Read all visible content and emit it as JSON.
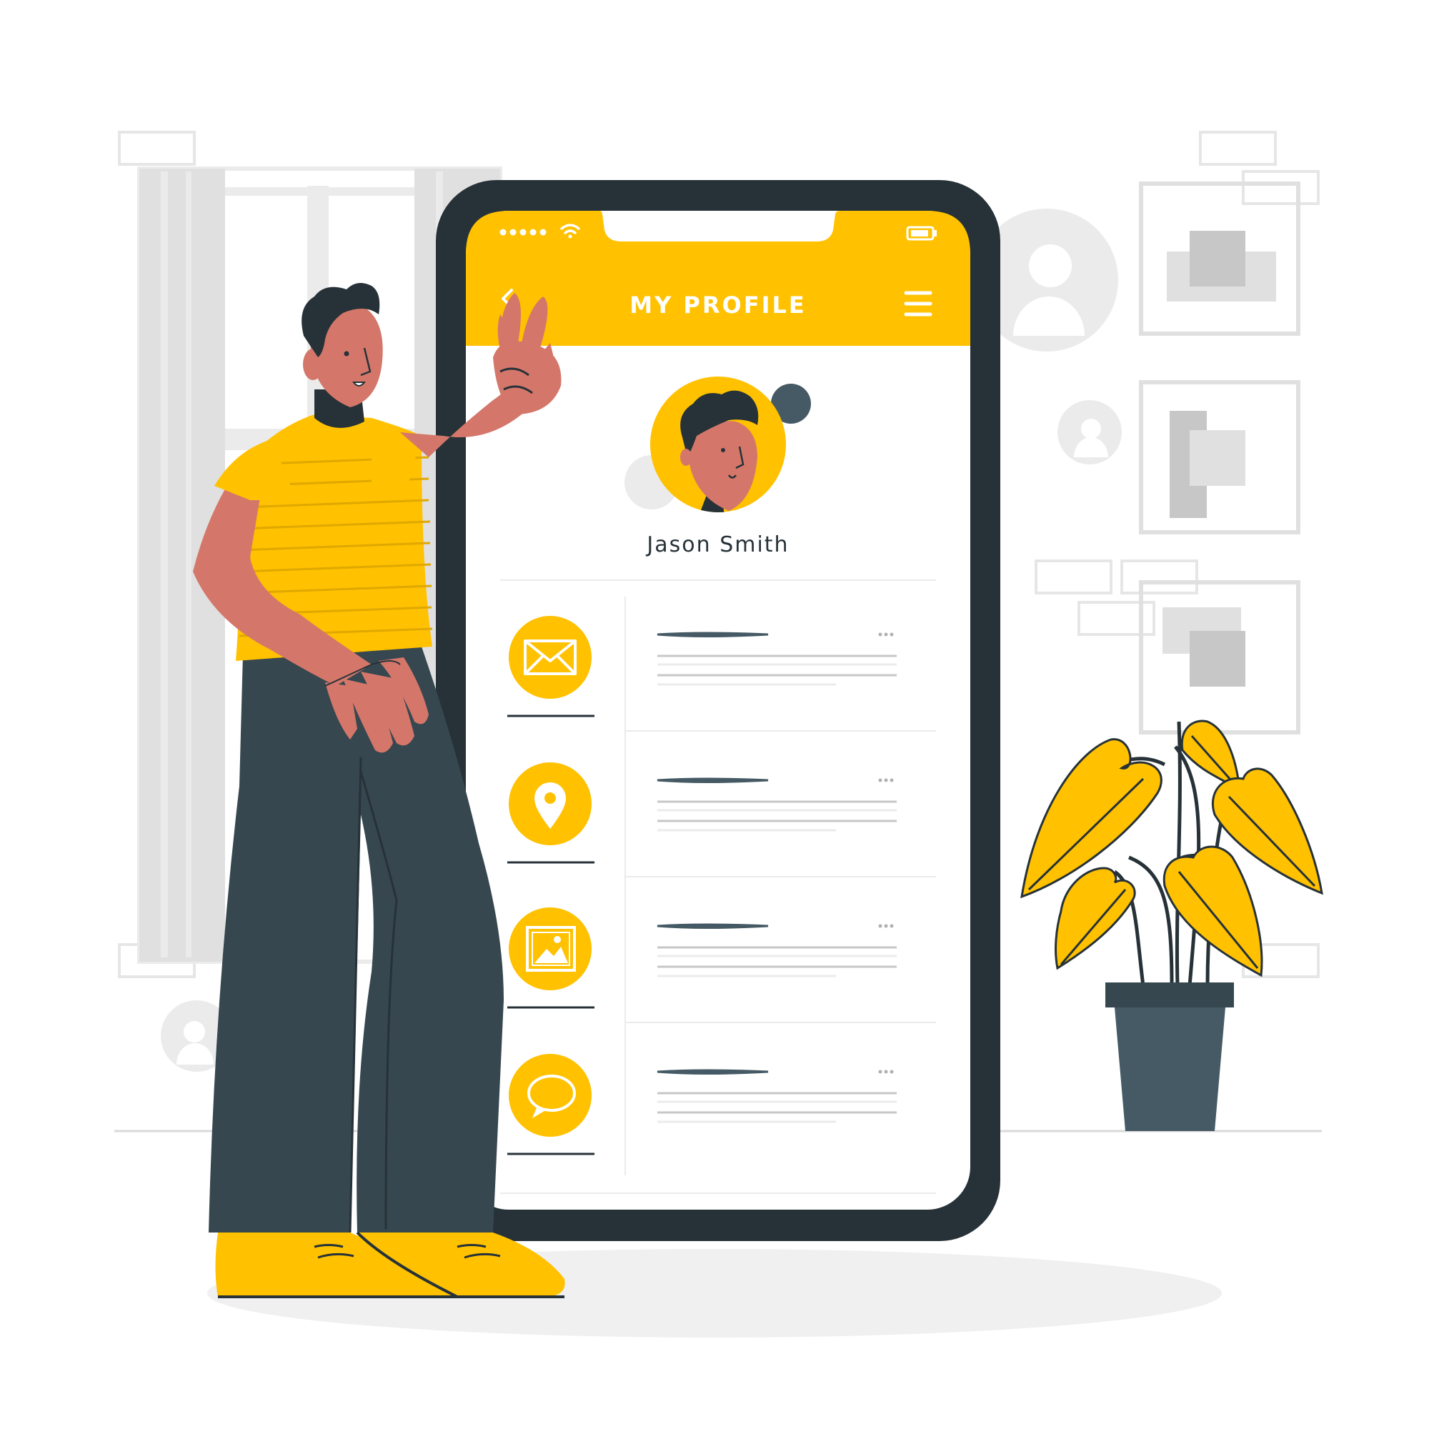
{
  "header": {
    "title": "MY PROFILE",
    "back_icon": "chevron-left-icon",
    "menu_icon": "hamburger-menu-icon"
  },
  "status_bar": {
    "signal_icon": "signal-dots-icon",
    "wifi_icon": "wifi-icon",
    "battery_icon": "battery-icon"
  },
  "profile": {
    "name": "Jason Smith",
    "avatar_icon": "user-avatar-icon"
  },
  "list": {
    "items": [
      {
        "icon": "mail-icon",
        "more_icon": "more-dots-icon"
      },
      {
        "icon": "location-pin-icon",
        "more_icon": "more-dots-icon"
      },
      {
        "icon": "image-gallery-icon",
        "more_icon": "more-dots-icon"
      },
      {
        "icon": "chat-bubble-icon",
        "more_icon": "more-dots-icon"
      }
    ]
  },
  "colors": {
    "accent": "#FFC100",
    "phone_frame": "#263238",
    "skin": "#D4776A",
    "pants": "#37474F",
    "background_gray": "#EBEBEB",
    "list_line": "#455A64"
  }
}
